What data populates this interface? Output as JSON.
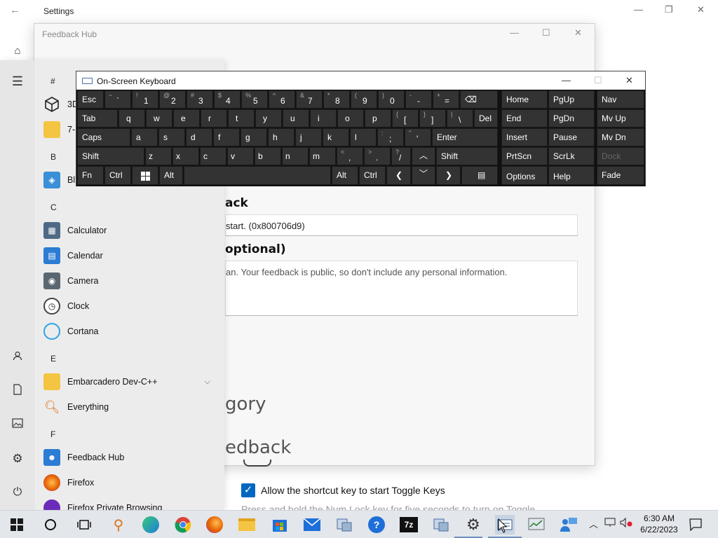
{
  "settings": {
    "title": "Settings",
    "back_glyph": "←",
    "minimize": "—",
    "restore": "❐",
    "close": "✕",
    "shortcut_checkbox_label": "Allow the shortcut key to start Toggle Keys",
    "shortcut_desc_cut": "Press and hold the Num Lock key for five seconds to turn on Toggle"
  },
  "feedback_hub": {
    "title": "Feedback Hub",
    "minimize": "—",
    "maximize": "☐",
    "close": "✕",
    "heading_feedback": "ack",
    "summary_value": "start. (0x800706d9)",
    "heading_optional": "optional)",
    "details_placeholder": "an. Your feedback is public, so don't include any personal information.",
    "heading_category": "gory",
    "heading_similar": "edback"
  },
  "start_menu": {
    "rail": [
      {
        "icon": "hamburger-icon"
      },
      {
        "icon": "user-icon"
      },
      {
        "icon": "documents-icon"
      },
      {
        "icon": "pictures-icon"
      },
      {
        "icon": "settings-icon"
      },
      {
        "icon": "power-icon"
      }
    ],
    "groups": {
      "hash": "#",
      "b": "B",
      "c": "C",
      "e": "E",
      "f": "F"
    },
    "apps": {
      "three_d": "3D",
      "seven": "7-",
      "bl": "Bl",
      "calculator": "Calculator",
      "calendar": "Calendar",
      "camera": "Camera",
      "clock": "Clock",
      "cortana": "Cortana",
      "embarcadero": "Embarcadero Dev-C++",
      "everything": "Everything",
      "feedback_hub": "Feedback Hub",
      "firefox": "Firefox",
      "firefox_private": "Firefox Private Browsing"
    }
  },
  "osk": {
    "title": "On-Screen Keyboard",
    "minimize": "—",
    "maximize": "☐",
    "close": "✕",
    "row1": [
      "Esc",
      "~ `",
      "! 1",
      "@ 2",
      "# 3",
      "$ 4",
      "% 5",
      "^ 6",
      "& 7",
      "* 8",
      "( 9",
      ") 0",
      "- -",
      "+ ="
    ],
    "keys": {
      "esc": "Esc",
      "tab": "Tab",
      "caps": "Caps",
      "shift_l": "Shift",
      "fn": "Fn",
      "ctrl_l": "Ctrl",
      "alt_l": "Alt",
      "alt_r": "Alt",
      "ctrl_r": "Ctrl",
      "shift_r": "Shift",
      "enter": "Enter",
      "del": "Del",
      "q": "q",
      "w": "w",
      "e": "e",
      "r": "r",
      "t": "t",
      "y": "y",
      "u": "u",
      "i": "i",
      "o": "o",
      "p": "p",
      "a": "a",
      "s": "s",
      "d": "d",
      "f": "f",
      "g": "g",
      "h": "h",
      "j": "j",
      "k": "k",
      "l": "l",
      "z": "z",
      "x": "x",
      "c": "c",
      "v": "v",
      "b": "b",
      "n": "n",
      "m": "m",
      "home": "Home",
      "pgup": "PgUp",
      "nav": "Nav",
      "end": "End",
      "pgdn": "PgDn",
      "mvup": "Mv Up",
      "insert": "Insert",
      "pause": "Pause",
      "mvdn": "Mv Dn",
      "prtscn": "PrtScn",
      "scrlk": "ScrLk",
      "dock": "Dock",
      "options": "Options",
      "help": "Help",
      "fade": "Fade",
      "backspace": "⌫",
      "left": "❮",
      "right": "❯",
      "up": "︿",
      "down": "﹀",
      "menu": "▤"
    },
    "sym": {
      "tilde_top": "~",
      "tilde_bot": "`",
      "n1_top": "!",
      "n1": "1",
      "n2_top": "@",
      "n2": "2",
      "n3_top": "#",
      "n3": "3",
      "n4_top": "$",
      "n4": "4",
      "n5_top": "%",
      "n5": "5",
      "n6_top": "^",
      "n6": "6",
      "n7_top": "&",
      "n7": "7",
      "n8_top": "*",
      "n8": "8",
      "n9_top": "(",
      "n9": "9",
      "n0_top": ")",
      "n0": "0",
      "minus_top": "-",
      "minus": "-",
      "plus_top": "+",
      "eq": "=",
      "lbr_top": "{",
      "lbr": "[",
      "rbr_top": "}",
      "rbr": "]",
      "pipe_top": "|",
      "bslash": "\\",
      "colon_top": ":",
      "semi": ";",
      "quot_top": "\"",
      "apos": "'",
      "lt_top": "<",
      "comma": ",",
      "gt_top": ">",
      "dot": ".",
      "q_top": "?",
      "slash": "/"
    }
  },
  "taskbar": {
    "time": "6:30 AM",
    "date": "6/22/2023",
    "icons": [
      "start-icon",
      "search-circle-icon",
      "task-view-icon",
      "everything-search-icon",
      "edge-icon",
      "chrome-icon",
      "firefox-icon",
      "file-explorer-icon",
      "store-icon",
      "mail-icon",
      "network-app-icon",
      "support-icon",
      "7zip-icon",
      "network-app-2-icon",
      "settings-gear-icon",
      "osk-app-icon",
      "performance-icon",
      "feedback-people-icon"
    ],
    "tray_up": "︿",
    "notif": "▭",
    "sevenzip": "7z"
  }
}
